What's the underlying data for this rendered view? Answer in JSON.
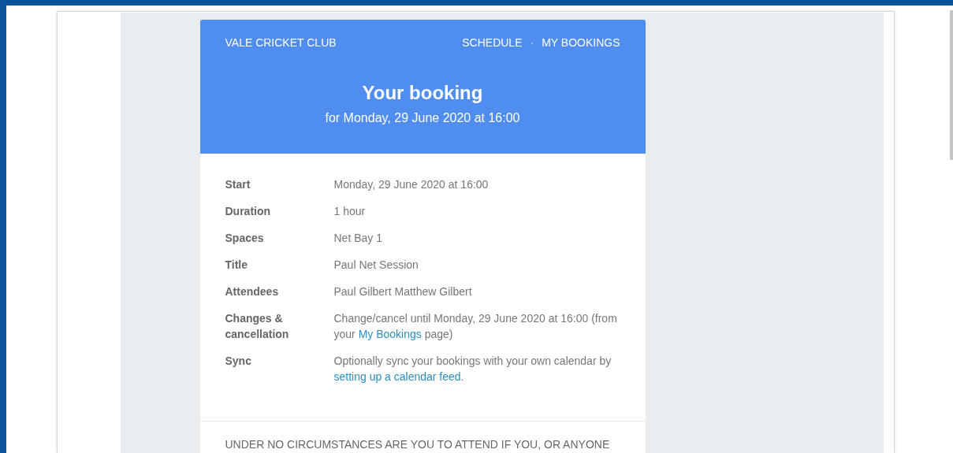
{
  "header": {
    "club_name": "VALE CRICKET CLUB",
    "nav": [
      {
        "label": "SCHEDULE"
      },
      {
        "label": "MY BOOKINGS"
      }
    ],
    "nav_separator": "·",
    "title": "Your booking",
    "subtitle": "for Monday, 29 June 2020 at 16:00"
  },
  "details": [
    {
      "label": "Start",
      "value": [
        {
          "kind": "text",
          "text": "Monday, 29 June 2020 at 16:00"
        }
      ]
    },
    {
      "label": "Duration",
      "value": [
        {
          "kind": "text",
          "text": "1 hour"
        }
      ]
    },
    {
      "label": "Spaces",
      "value": [
        {
          "kind": "text",
          "text": "Net Bay 1"
        }
      ]
    },
    {
      "label": "Title",
      "value": [
        {
          "kind": "text",
          "text": "Paul Net Session"
        }
      ]
    },
    {
      "label": "Attendees",
      "value": [
        {
          "kind": "text",
          "text": "Paul Gilbert Matthew Gilbert"
        }
      ]
    },
    {
      "label": "Changes & cancellation",
      "value": [
        {
          "kind": "text",
          "text": "Change/cancel until Monday, 29 June 2020 at 16:00 (from your "
        },
        {
          "kind": "link",
          "text": "My Bookings"
        },
        {
          "kind": "text",
          "text": " page)"
        }
      ]
    },
    {
      "label": "Sync",
      "value": [
        {
          "kind": "text",
          "text": "Optionally sync your bookings with your own calendar by "
        },
        {
          "kind": "link",
          "text": "setting up a calendar feed"
        },
        {
          "kind": "text",
          "text": "."
        }
      ]
    }
  ],
  "notice": "UNDER NO CIRCUMSTANCES ARE YOU TO ATTEND IF YOU, OR ANYONE"
}
